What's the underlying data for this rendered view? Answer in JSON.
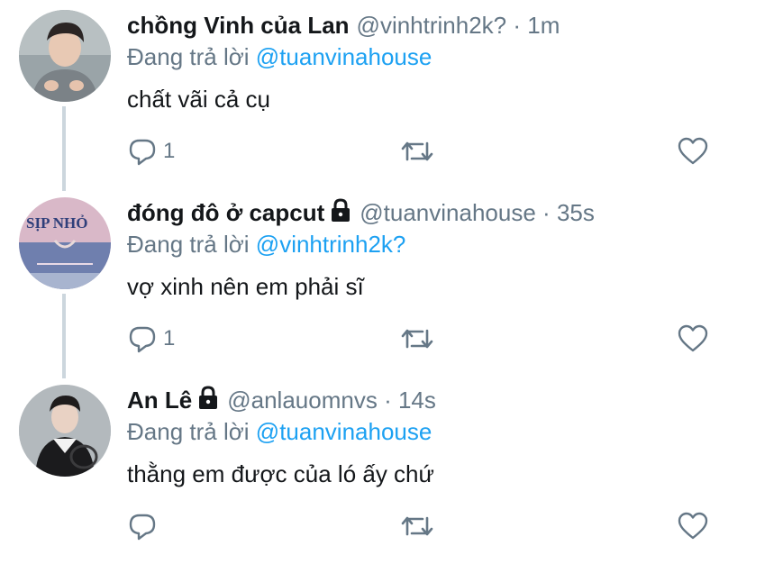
{
  "colors": {
    "accent": "#1da1f2",
    "secondary_text": "#657786",
    "primary_text": "#14171a",
    "thread_line": "#ccd6dd"
  },
  "tweets": [
    {
      "display_name": "chồng Vinh của Lan",
      "locked": false,
      "handle": "@vinhtrinh2k?",
      "separator": "·",
      "time": "1m",
      "reply_prefix": "Đang trả lời",
      "reply_to": "@tuanvinahouse",
      "text": "chất vãi cả cụ",
      "reply_count": "1",
      "avatar_icon": "avatar-photo"
    },
    {
      "display_name": "đóng đô ở capcut",
      "locked": true,
      "handle": "@tuanvinahouse",
      "separator": "·",
      "time": "35s",
      "reply_prefix": "Đang trả lời",
      "reply_to": "@vinhtrinh2k?",
      "text": "vợ xinh nên em phải sĩ",
      "reply_count": "1",
      "avatar_icon": "avatar-sign",
      "avatar_text": "SỊP NHỎ"
    },
    {
      "display_name": "An Lê",
      "locked": true,
      "handle": "@anlauomnvs",
      "separator": "·",
      "time": "14s",
      "reply_prefix": "Đang trả lời",
      "reply_to": "@tuanvinahouse",
      "text": "thằng em được của ló ấy chứ",
      "reply_count": "",
      "avatar_icon": "avatar-photo"
    }
  ],
  "icons": {
    "reply": "reply-icon",
    "retweet": "retweet-icon",
    "like": "heart-icon",
    "lock": "lock-icon"
  }
}
